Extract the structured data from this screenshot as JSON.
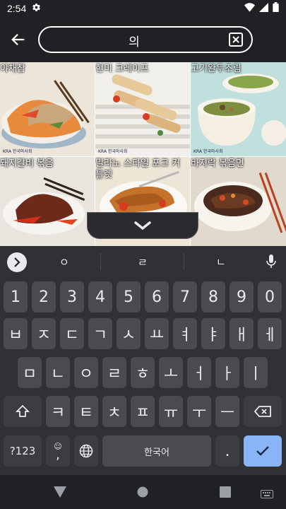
{
  "status": {
    "time": "2:54"
  },
  "search": {
    "value": "의"
  },
  "tiles": [
    {
      "label": "야채찹"
    },
    {
      "label": "현미 크레이프"
    },
    {
      "label": "고기완두조림"
    },
    {
      "label": "돼지갈비 볶음"
    },
    {
      "label": "밀라노 스타일 포크 커틀렛"
    },
    {
      "label": "바지락 볶음면"
    }
  ],
  "watermark": "KRA 한국마사회",
  "suggestions": [
    "ㅇ",
    "ㄹ",
    "ㄴ"
  ],
  "keyboard": {
    "row1": [
      "1",
      "2",
      "3",
      "4",
      "5",
      "6",
      "7",
      "8",
      "9",
      "0"
    ],
    "row2": [
      "ㅂ",
      "ㅈ",
      "ㄷ",
      "ㄱ",
      "ㅅ",
      "ㅛ",
      "ㅕ",
      "ㅑ",
      "ㅐ",
      "ㅔ"
    ],
    "row3": [
      "ㅁ",
      "ㄴ",
      "ㅇ",
      "ㄹ",
      "ㅎ",
      "ㅗ",
      "ㅓ",
      "ㅏ",
      "ㅣ"
    ],
    "row4": [
      "ㅋ",
      "ㅌ",
      "ㅊ",
      "ㅍ",
      "ㅠ",
      "ㅜ",
      "ㅡ"
    ],
    "symbols": "?123",
    "comma": ",",
    "space": "한국어",
    "period": "."
  },
  "colors": {
    "accent": "#8ab4f8",
    "key": "#4a4b4f",
    "keyboard_bg": "#303134"
  }
}
